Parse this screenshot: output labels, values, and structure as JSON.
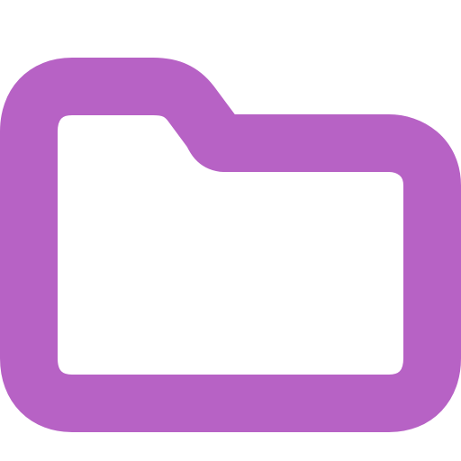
{
  "icon": {
    "name": "folder-icon",
    "stroke_color": "#B762C5",
    "fill_color": "#FFFFFF",
    "background_color": "#FFFFFF"
  }
}
